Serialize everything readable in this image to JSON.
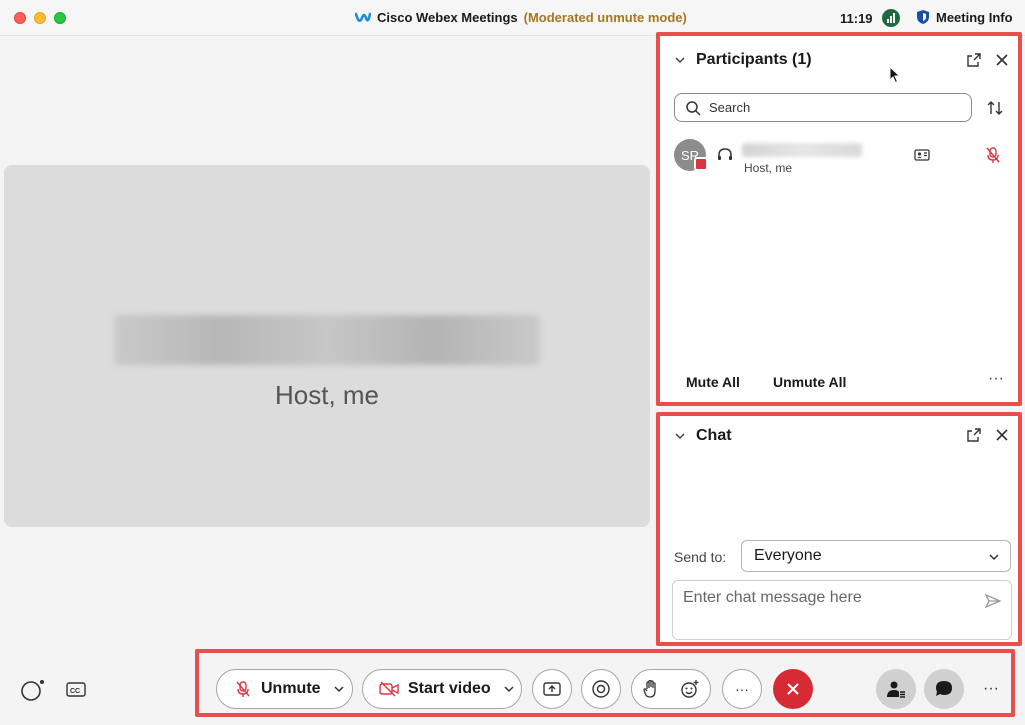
{
  "window": {
    "app_name": "Cisco Webex Meetings",
    "mode": "(Moderated unmute mode)",
    "time": "11:19",
    "meeting_info_label": "Meeting Info"
  },
  "stage": {
    "subtitle": "Host, me"
  },
  "participants": {
    "title": "Participants (1)",
    "search_placeholder": "Search",
    "list": [
      {
        "initials": "SR",
        "role": "Host, me",
        "muted": true
      }
    ],
    "mute_all_label": "Mute All",
    "unmute_all_label": "Unmute All",
    "more_label": "···"
  },
  "chat": {
    "title": "Chat",
    "send_to_label": "Send to:",
    "recipient": "Everyone",
    "input_placeholder": "Enter chat message here"
  },
  "toolbar": {
    "unmute_label": "Unmute",
    "start_video_label": "Start video",
    "more_label": "···",
    "right_more_label": "···"
  },
  "colors": {
    "highlight": "#e8504d",
    "end_call": "#d62b35",
    "mute_red": "#d93642",
    "mode_text": "#a8761f"
  }
}
